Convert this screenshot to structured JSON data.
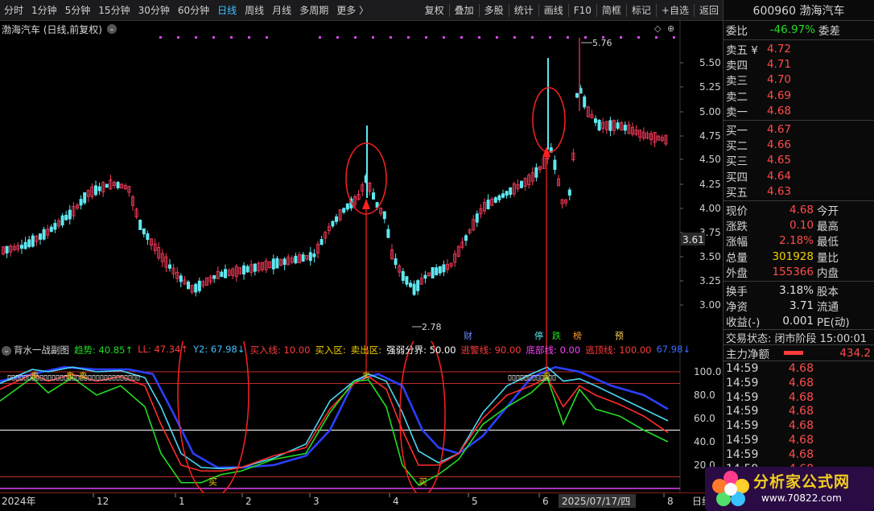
{
  "toolbar": {
    "periods": [
      "分时",
      "1分钟",
      "5分钟",
      "15分钟",
      "30分钟",
      "60分钟",
      "日线",
      "周线",
      "月线",
      "多周期",
      "更多 〉"
    ],
    "active_period": "日线",
    "tools": [
      "复权",
      "叠加",
      "多股",
      "统计",
      "画线",
      "F10",
      "简框",
      "标记",
      "+自选",
      "返回"
    ]
  },
  "main": {
    "title": "渤海汽车 (日线,前复权)",
    "price_axis": [
      "5.50",
      "5.25",
      "5.00",
      "4.75",
      "4.50",
      "4.25",
      "4.00",
      "3.75",
      "3.50",
      "3.25",
      "3.00"
    ],
    "current_price_marker": "3.61",
    "high_label": "5.76",
    "low_label": "2.78",
    "events": [
      "财",
      "停",
      "跌",
      "榜",
      "预"
    ]
  },
  "sub": {
    "title": "背水一战副图",
    "legend": [
      {
        "text": "趋势: 40.85↑",
        "color": "#22dd22"
      },
      {
        "text": "LL: 47.34↑",
        "color": "#ff3b3b"
      },
      {
        "text": "Y2: 67.98↓",
        "color": "#3fc1ff"
      },
      {
        "text": "买入线: 10.00",
        "color": "#ff3b3b"
      },
      {
        "text": "买入区:",
        "color": "#f2d000"
      },
      {
        "text": "卖出区:",
        "color": "#f2d000"
      },
      {
        "text": "强弱分界: 50.00",
        "color": "#ffffff"
      },
      {
        "text": "逃警线: 90.00",
        "color": "#ff3b3b"
      },
      {
        "text": "底部线: 0.00",
        "color": "#ff40ff"
      },
      {
        "text": "逃顶线: 100.00",
        "color": "#ff3b3b"
      },
      {
        "text": "67.98↓",
        "color": "#3a6dff"
      }
    ],
    "axis": [
      "100.0",
      "80.0",
      "60.0",
      "40.0",
      "20.0"
    ],
    "signal_buy": "买",
    "signal_sell": "卖"
  },
  "bottom_axis": [
    "2024年",
    "12",
    "1",
    "2",
    "3",
    "4",
    "5",
    "6",
    "2025/07/17/四",
    "8",
    "日线"
  ],
  "quote": {
    "code_name": "600960 渤海汽车",
    "weibi_label": "委比",
    "weibi_value": "-46.97%",
    "weicha_label": "委差",
    "sell": [
      {
        "label": "卖五 ¥",
        "price": "4.72"
      },
      {
        "label": "卖四",
        "price": "4.71"
      },
      {
        "label": "卖三",
        "price": "4.70"
      },
      {
        "label": "卖二",
        "price": "4.69"
      },
      {
        "label": "卖一",
        "price": "4.68"
      }
    ],
    "buy": [
      {
        "label": "买一",
        "price": "4.67"
      },
      {
        "label": "买二",
        "price": "4.66"
      },
      {
        "label": "买三",
        "price": "4.65"
      },
      {
        "label": "买四",
        "price": "4.64"
      },
      {
        "label": "买五",
        "price": "4.63"
      }
    ],
    "stats": [
      {
        "k": "现价",
        "v": "4.68",
        "vc": "red",
        "k2": "今开"
      },
      {
        "k": "涨跌",
        "v": "0.10",
        "vc": "red",
        "k2": "最高"
      },
      {
        "k": "涨幅",
        "v": "2.18%",
        "vc": "red",
        "k2": "最低"
      },
      {
        "k": "总量",
        "v": "301928",
        "vc": "yellow",
        "k2": "量比"
      },
      {
        "k": "外盘",
        "v": "155366",
        "vc": "red",
        "k2": "内盘"
      }
    ],
    "stats2": [
      {
        "k": "换手",
        "v": "3.18%",
        "vc": "white",
        "k2": "股本"
      },
      {
        "k": "净资",
        "v": "3.71",
        "vc": "white",
        "k2": "流通"
      },
      {
        "k": "收益(-)",
        "v": "0.001",
        "vc": "white",
        "k2": "PE(动)"
      }
    ],
    "trade_status": "交易状态: 闭市阶段 15:00:01",
    "net_label": "主力净额",
    "net_value": "434.2",
    "ticks": [
      {
        "t": "14:59",
        "p": "4.68"
      },
      {
        "t": "14:59",
        "p": "4.68"
      },
      {
        "t": "14:59",
        "p": "4.68"
      },
      {
        "t": "14:59",
        "p": "4.68"
      },
      {
        "t": "14:59",
        "p": "4.68"
      },
      {
        "t": "14:59",
        "p": "4.68"
      },
      {
        "t": "14:59",
        "p": "4.68"
      },
      {
        "t": "14:59",
        "p": "4.68"
      }
    ]
  },
  "watermark": {
    "title": "分析家公式网",
    "url": "www.70822.com"
  }
}
